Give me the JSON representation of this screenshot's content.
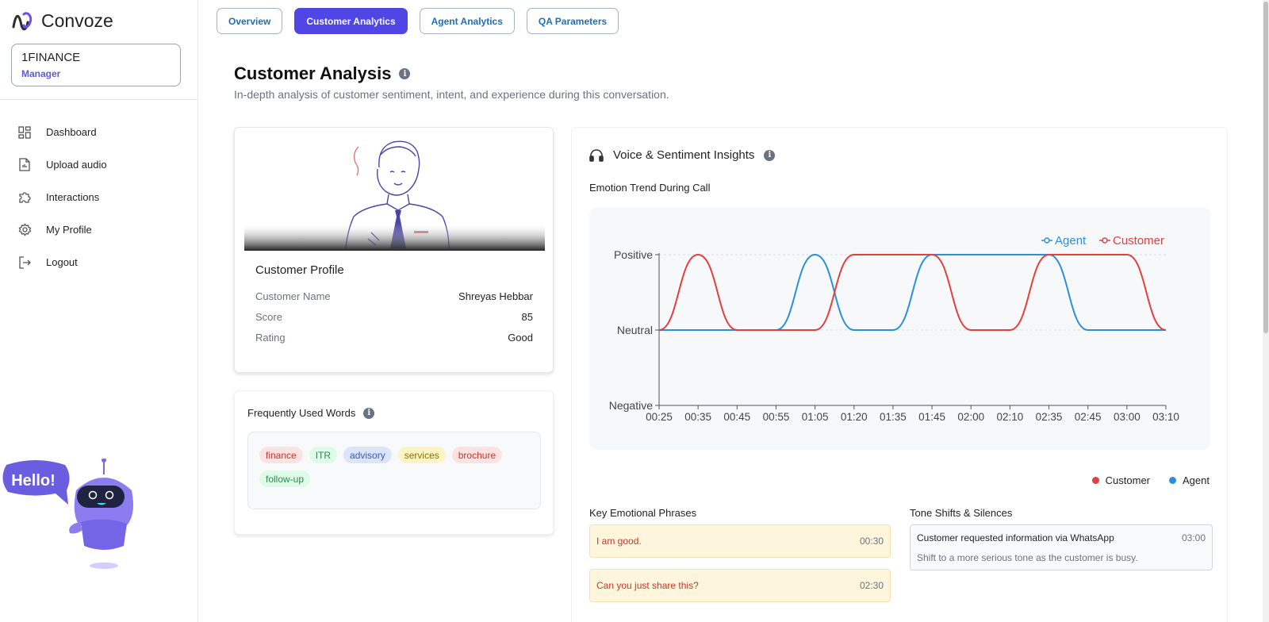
{
  "app": {
    "name": "Convoze"
  },
  "org": {
    "name": "1FINANCE",
    "role": "Manager"
  },
  "nav": [
    {
      "label": "Dashboard",
      "icon": "dashboard-icon"
    },
    {
      "label": "Upload audio",
      "icon": "upload-file-icon"
    },
    {
      "label": "Interactions",
      "icon": "puzzle-icon"
    },
    {
      "label": "My Profile",
      "icon": "gear-icon"
    },
    {
      "label": "Logout",
      "icon": "logout-icon"
    }
  ],
  "bot": {
    "bubble": "Hello!"
  },
  "tabs": [
    {
      "label": "Overview",
      "active": false
    },
    {
      "label": "Customer Analytics",
      "active": true
    },
    {
      "label": "Agent Analytics",
      "active": false
    },
    {
      "label": "QA Parameters",
      "active": false
    }
  ],
  "header": {
    "title": "Customer Analysis",
    "subtitle": "In-depth analysis of customer sentiment, intent, and experience during this conversation."
  },
  "profile": {
    "title": "Customer Profile",
    "rows": [
      {
        "label": "Customer Name",
        "value": "Shreyas Hebbar"
      },
      {
        "label": "Score",
        "value": "85"
      },
      {
        "label": "Rating",
        "value": "Good"
      }
    ]
  },
  "words": {
    "title": "Frequently Used Words",
    "chips": [
      {
        "text": "finance",
        "bg": "#fde2e2",
        "fg": "#c0392b"
      },
      {
        "text": "ITR",
        "bg": "#dcfce7",
        "fg": "#2f855a"
      },
      {
        "text": "advisory",
        "bg": "#dbe4fb",
        "fg": "#3b5bb5"
      },
      {
        "text": "services",
        "bg": "#fdf4c4",
        "fg": "#8a6d0a"
      },
      {
        "text": "brochure",
        "bg": "#fde2e2",
        "fg": "#c0392b"
      },
      {
        "text": "follow-up",
        "bg": "#dcfce7",
        "fg": "#2f855a"
      }
    ]
  },
  "voice": {
    "title": "Voice & Sentiment Insights",
    "emotion_label": "Emotion Trend During Call",
    "legend_bottom": [
      {
        "label": "Customer",
        "color": "#e53e3e"
      },
      {
        "label": "Agent",
        "color": "#2b8fd9"
      }
    ],
    "phrases_title": "Key Emotional Phrases",
    "phrases": [
      {
        "text": "I am good.",
        "time": "00:30"
      },
      {
        "text": "Can you just share this?",
        "time": "02:30"
      }
    ],
    "shifts_title": "Tone Shifts & Silences",
    "shifts": [
      {
        "text": "Customer requested information via WhatsApp",
        "time": "03:00",
        "desc": "Shift to a more serious tone as the customer is busy."
      }
    ]
  },
  "chart_data": {
    "type": "line",
    "x": [
      "00:25",
      "00:35",
      "00:45",
      "00:55",
      "01:05",
      "01:20",
      "01:35",
      "01:45",
      "02:00",
      "02:10",
      "02:35",
      "02:45",
      "03:00",
      "03:10"
    ],
    "y_categories": [
      "Negative",
      "Neutral",
      "Positive"
    ],
    "series": [
      {
        "name": "Agent",
        "color": "#2b8fd9",
        "values": [
          "Neutral",
          "Neutral",
          "Neutral",
          "Neutral",
          "Positive",
          "Neutral",
          "Neutral",
          "Positive",
          "Positive",
          "Positive",
          "Positive",
          "Neutral",
          "Neutral",
          "Neutral"
        ]
      },
      {
        "name": "Customer",
        "color": "#e53e3e",
        "values": [
          "Neutral",
          "Positive",
          "Neutral",
          "Neutral",
          "Neutral",
          "Positive",
          "Positive",
          "Positive",
          "Neutral",
          "Neutral",
          "Positive",
          "Positive",
          "Positive",
          "Neutral"
        ]
      }
    ],
    "legend_position": "top-right",
    "grid": true
  }
}
